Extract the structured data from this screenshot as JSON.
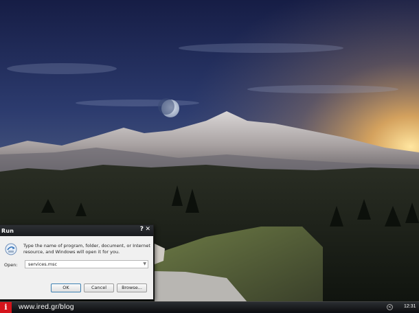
{
  "run_dialog": {
    "title": "Run",
    "help_glyph": "?",
    "close_glyph": "✕",
    "description": "Type the name of program, folder, document, or Internet resource, and Windows will open it for you.",
    "open_label": "Open:",
    "open_value": "services.msc",
    "buttons": {
      "ok": "OK",
      "cancel": "Cancel",
      "browse": "Browse..."
    }
  },
  "taskbar": {
    "start_glyph": "i",
    "watermark": "www.ired.gr/blog",
    "tray_glyph": "<",
    "clock": "12:31"
  },
  "icons": [
    "run-icon",
    "dropdown-arrow-icon",
    "tray-chevron-icon",
    "start-logo-icon"
  ],
  "colors": {
    "start_red": "#d4141b",
    "titlebar": "#1f2225",
    "sky_top": "#1a2248",
    "sunset": "#f4b04a"
  }
}
